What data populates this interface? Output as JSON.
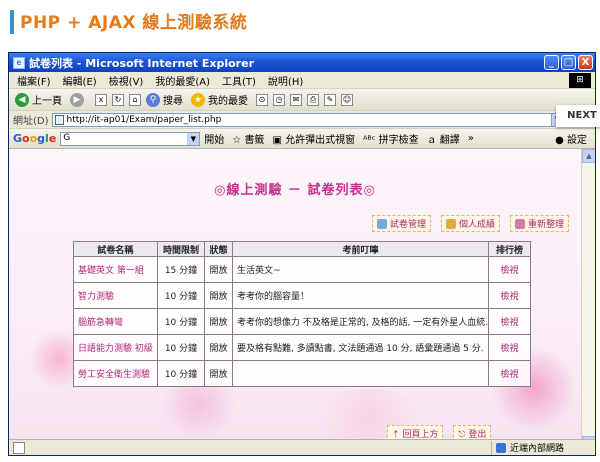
{
  "slide": {
    "title": "PHP + AJAX 線上測驗系統",
    "next_label": "NEXT"
  },
  "window": {
    "title": "試卷列表 - Microsoft Internet Explorer",
    "min": "_",
    "max": "□",
    "close": "X"
  },
  "menu": {
    "items": [
      "檔案(F)",
      "編輯(E)",
      "檢視(V)",
      "我的最愛(A)",
      "工具(T)",
      "說明(H)"
    ]
  },
  "toolbar": {
    "back": "上一頁",
    "search": "搜尋",
    "favorites": "我的最愛"
  },
  "address": {
    "label": "網址(D)",
    "url": "http://it-ap01/Exam/paper_list.php"
  },
  "google": {
    "logo_g1": "G",
    "logo_o1": "o",
    "logo_o2": "o",
    "logo_g2": "g",
    "logo_l": "l",
    "logo_e": "e",
    "search_value": "G",
    "go": "開始",
    "bookmarks": "書籤",
    "popup": "允許彈出式視窗",
    "spell": "拼字檢查",
    "translate": "翻譯",
    "more": "»",
    "settings": "設定"
  },
  "page": {
    "heading": "◎線上測驗 － 試卷列表◎",
    "actions": [
      "試卷管理",
      "個人成績",
      "重新整理"
    ],
    "columns": [
      "試卷名稱",
      "時間限制",
      "狀態",
      "考前叮嚀",
      "排行榜"
    ],
    "rows": [
      {
        "name": "基礎英文 第一組",
        "time": "15 分鐘",
        "status": "開放",
        "note": "生活英文~",
        "view": "檢視"
      },
      {
        "name": "智力測驗",
        "time": "10 分鐘",
        "status": "開放",
        "note": "考考你的腦容量！",
        "view": "檢視"
      },
      {
        "name": "腦筋急轉彎",
        "time": "10 分鐘",
        "status": "開放",
        "note": "考考你的想像力 不及格是正常的, 及格的話, 一定有外星人血統...",
        "view": "檢視"
      },
      {
        "name": "日語能力測驗 初級",
        "time": "10 分鐘",
        "status": "開放",
        "note": "要及格有點難, 多讀點書, 文法題通過 10 分, 語彙題通過 5 分.",
        "view": "檢視"
      },
      {
        "name": "勞工安全衛生測驗",
        "time": "10 分鐘",
        "status": "開放",
        "note": "",
        "view": "檢視"
      }
    ],
    "bottom_links": [
      "回頁上方",
      "登出"
    ]
  },
  "status": {
    "zone": "近端內部網路"
  },
  "colors": {
    "accent": "#c0308a",
    "title_orange": "#e47b1a",
    "ie_blue": "#1b55d4"
  }
}
